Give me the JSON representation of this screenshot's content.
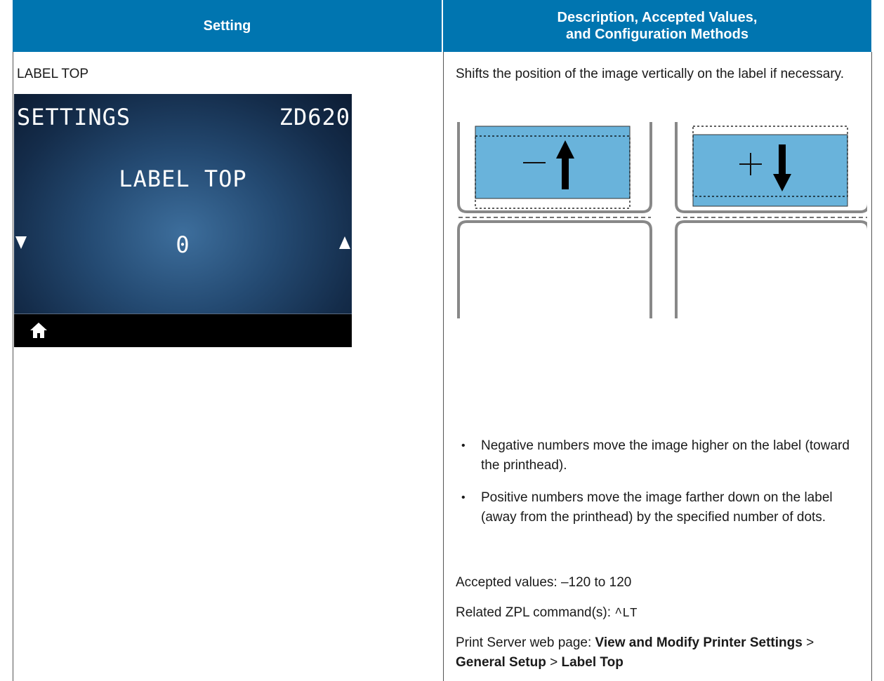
{
  "table": {
    "headers": {
      "setting": "Setting",
      "description_line1": "Description, Accepted Values,",
      "description_line2": "and Configuration Methods"
    }
  },
  "row": {
    "setting_name": "LABEL TOP",
    "display": {
      "menu_title": "SETTINGS",
      "model": "ZD620",
      "item_name": "LABEL TOP",
      "value": "0",
      "icons": [
        "decrease-arrow-icon",
        "increase-arrow-icon",
        "home-icon"
      ],
      "colors": {
        "background": "#1f3f63",
        "bar": "#000000",
        "text": "#ffffff"
      }
    },
    "description": {
      "intro": "Shifts the position of the image vertically on the label if necessary.",
      "bullets": [
        "Negative numbers move the image higher on the label (toward the printhead).",
        "Positive numbers move the image farther down on the label (away from the printhead) by the specified number of dots."
      ],
      "accepted_values": "Accepted values: –120 to 120",
      "zpl_label": "Related ZPL command(s):",
      "zpl_command": "^LT",
      "web_label": "Print Server web page:",
      "web_path": [
        "View and Modify Printer Settings",
        "General Setup",
        "Label Top"
      ],
      "separator": ">"
    }
  },
  "colors": {
    "header_bg": "#0075b0",
    "label_fill": "#69b3db"
  }
}
